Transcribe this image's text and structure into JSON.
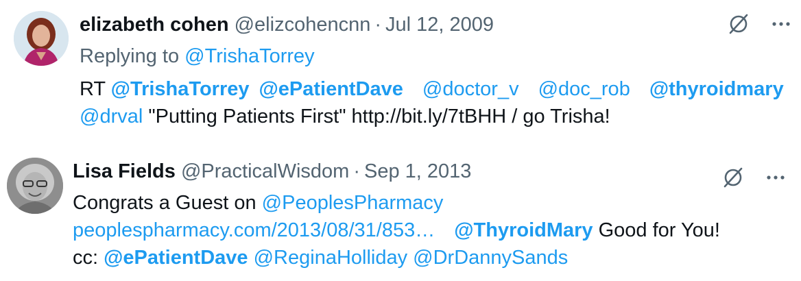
{
  "tweets": [
    {
      "name": "elizabeth cohen",
      "handle": "@elizcohencnn",
      "separator": "·",
      "date": "Jul 12, 2009",
      "replying_prefix": "Replying to ",
      "replying_to": "@TrishaTorrey",
      "line1": {
        "rt": "RT ",
        "m1": "@TrishaTorrey",
        "m2": "@ePatientDave",
        "m3": "@doctor_v",
        "m4": "@doc_rob",
        "m5": "@thyroidmary"
      },
      "line2": {
        "m6": "@drval",
        "text": " \"Putting Patients First\"  http://bit.ly/7tBHH / go Trisha!"
      },
      "icons": [
        "grok-icon",
        "more-icon"
      ]
    },
    {
      "name": "Lisa Fields",
      "handle": "@PracticalWisdom",
      "separator": "·",
      "date": "Sep 1, 2013",
      "line1": {
        "text": "Congrats a Guest on ",
        "m1": "@PeoplesPharmacy"
      },
      "line2": {
        "url": "peoplespharmacy.com/2013/08/31/853…",
        "m2": "@ThyroidMary",
        "text": " Good for You!"
      },
      "line3": {
        "cc": "cc: ",
        "m3": "@ePatientDave",
        "m4": "@ReginaHolliday",
        "m5": "@DrDannySands"
      },
      "icons": [
        "grok-icon",
        "more-icon"
      ]
    }
  ],
  "colors": {
    "link": "#1d9bf0",
    "muted": "#536471",
    "text": "#0f1419"
  }
}
